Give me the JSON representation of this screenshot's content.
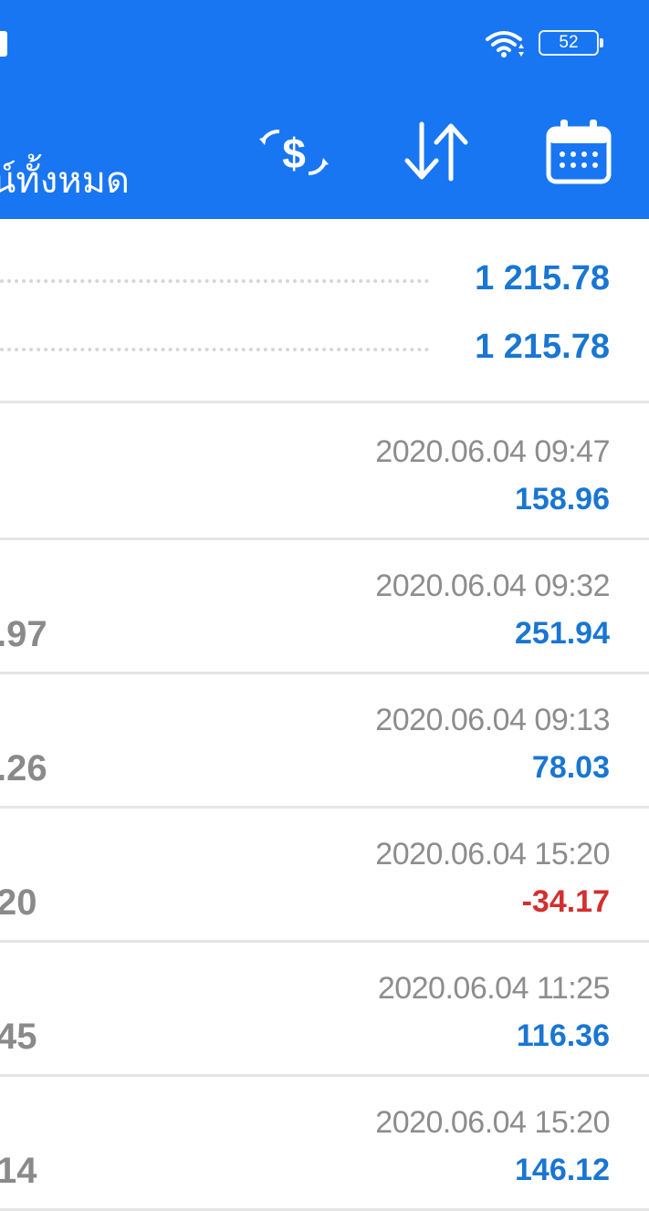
{
  "status_bar": {
    "battery_level": "52",
    "wifi_icon": "wifi-icon"
  },
  "toolbar": {
    "title": "น์ทั้งหมด",
    "icons": [
      "currency-exchange-icon",
      "sort-icon",
      "calendar-icon"
    ]
  },
  "summary": {
    "values": [
      "1 215.78",
      "1 215.78"
    ]
  },
  "deals": [
    {
      "time": "2020.06.04 09:47",
      "profit": "158.96",
      "left": "",
      "negative": false
    },
    {
      "time": "2020.06.04 09:32",
      "profit": "251.94",
      "left": ".97",
      "negative": false
    },
    {
      "time": "2020.06.04 09:13",
      "profit": "78.03",
      "left": ".26",
      "negative": false
    },
    {
      "time": "2020.06.04 15:20",
      "profit": "-34.17",
      "left": "20",
      "negative": true
    },
    {
      "time": "2020.06.04 11:25",
      "profit": "116.36",
      "left": "45",
      "negative": false
    },
    {
      "time": "2020.06.04 15:20",
      "profit": "146.12",
      "left": "14",
      "negative": false
    }
  ],
  "colors": {
    "appbar": "#1976f2",
    "positive": "#1976d2",
    "negative": "#d32f2f"
  }
}
